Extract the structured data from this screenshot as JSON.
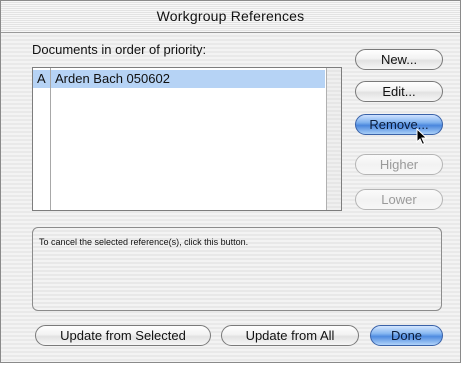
{
  "window": {
    "title": "Workgroup References"
  },
  "documents": {
    "label": "Documents in order of priority:",
    "rows": [
      {
        "letter": "A",
        "name": "Arden Bach 050602",
        "selected": true
      }
    ]
  },
  "buttons": {
    "new": "New...",
    "edit": "Edit...",
    "remove": "Remove...",
    "higher": "Higher",
    "lower": "Lower",
    "update_selected": "Update from Selected",
    "update_all": "Update from All",
    "done": "Done"
  },
  "help": {
    "text": "To cancel the selected reference(s), click this button."
  },
  "colors": {
    "selection": "#b6d3f5",
    "accent": "#4a86dd"
  }
}
